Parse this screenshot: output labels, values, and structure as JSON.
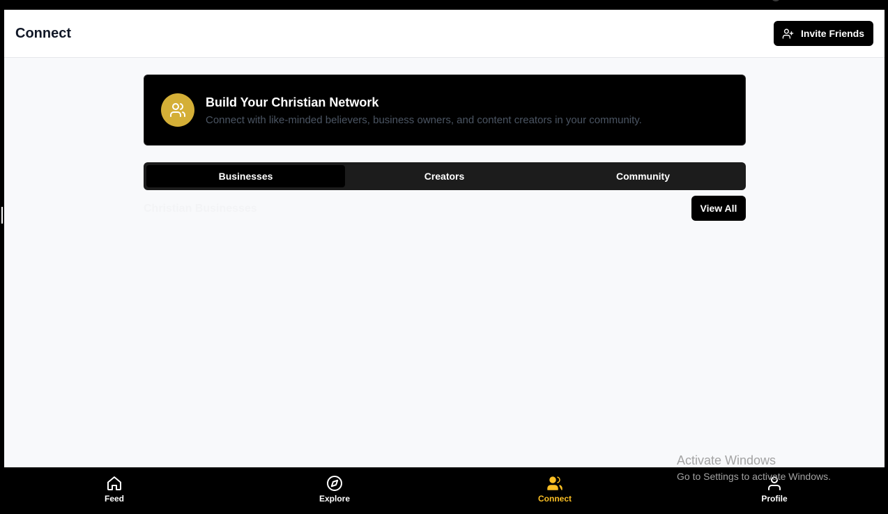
{
  "header": {
    "title": "Connect",
    "invite_label": "Invite Friends",
    "invite_icon": "user-plus-icon"
  },
  "hero": {
    "icon": "users-icon",
    "icon_color": "#d4af37",
    "title": "Build Your Christian Network",
    "subtitle": "Connect with like-minded believers, business owners, and content creators in your community."
  },
  "tabs": [
    {
      "label": "Businesses",
      "active": true
    },
    {
      "label": "Creators",
      "active": false
    },
    {
      "label": "Community",
      "active": false
    }
  ],
  "section": {
    "title": "Christian Businesses",
    "view_all_label": "View All"
  },
  "bottom_nav": [
    {
      "label": "Feed",
      "icon": "home-icon",
      "active": false
    },
    {
      "label": "Explore",
      "icon": "compass-icon",
      "active": false
    },
    {
      "label": "Connect",
      "icon": "users-icon",
      "active": true
    },
    {
      "label": "Profile",
      "icon": "user-icon",
      "active": false
    }
  ],
  "colors": {
    "accent": "#fbbf24",
    "brand_gold": "#d4af37",
    "background": "#f8f9fb"
  },
  "watermark": {
    "title": "Activate Windows",
    "subtitle": "Go to Settings to activate Windows."
  }
}
